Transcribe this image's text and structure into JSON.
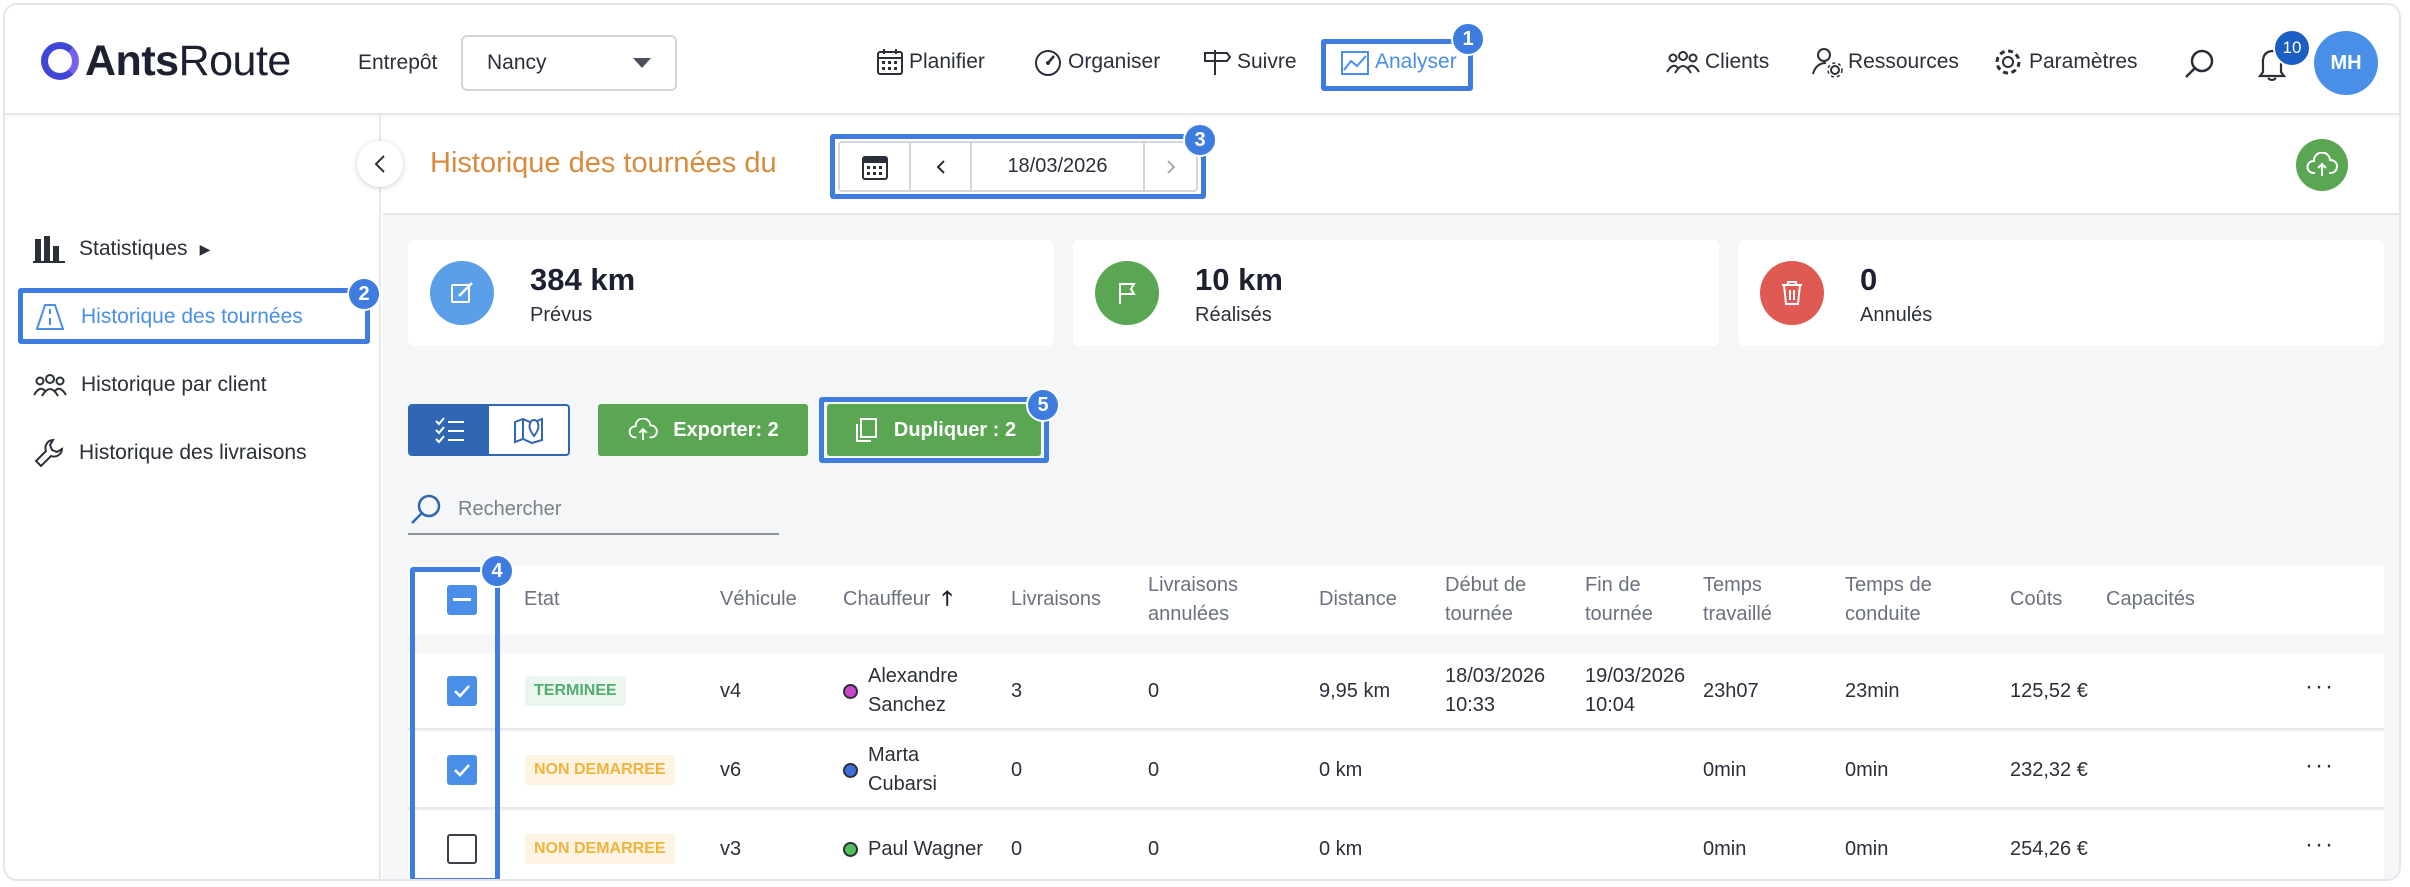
{
  "app": {
    "logo_bold": "Ants",
    "logo_light": "Route"
  },
  "header": {
    "entrepot_label": "Entrepôt",
    "entrepot_value": "Nancy",
    "nav": [
      {
        "label": "Planifier",
        "icon": "calendar-icon"
      },
      {
        "label": "Organiser",
        "icon": "gauge-icon"
      },
      {
        "label": "Suivre",
        "icon": "signpost-icon"
      },
      {
        "label": "Analyser",
        "icon": "chart-icon"
      }
    ],
    "right_nav": [
      {
        "label": "Clients",
        "icon": "people-icon"
      },
      {
        "label": "Ressources",
        "icon": "user-gear-icon"
      },
      {
        "label": "Paramètres",
        "icon": "gear-icon"
      }
    ],
    "notification_count": "10",
    "avatar_initials": "MH"
  },
  "annotations": [
    "1",
    "2",
    "3",
    "4",
    "5"
  ],
  "sidebar": {
    "items": [
      {
        "label": "Statistiques",
        "arrow": "▶"
      },
      {
        "label": "Historique des tournées"
      },
      {
        "label": "Historique par client"
      },
      {
        "label": "Historique des livraisons"
      }
    ]
  },
  "content": {
    "title": "Historique des tournées du",
    "date": "18/03/2026"
  },
  "stats": [
    {
      "value": "384 km",
      "label": "Prévus",
      "color": "#5b9fe8"
    },
    {
      "value": "10 km",
      "label": "Réalisés",
      "color": "#5aa653"
    },
    {
      "value": "0",
      "label": "Annulés",
      "color": "#df5a52"
    }
  ],
  "toolbar": {
    "export_label": "Exporter: 2",
    "duplicate_label": "Dupliquer : 2",
    "search_placeholder": "Rechercher"
  },
  "table": {
    "headers": {
      "etat": "Etat",
      "vehicule": "Véhicule",
      "chauffeur": "Chauffeur",
      "sort_indicator": "🡑",
      "livraisons": "Livraisons",
      "livraisons_annulees_1": "Livraisons",
      "livraisons_annulees_2": "annulées",
      "distance": "Distance",
      "debut_1": "Début de",
      "debut_2": "tournée",
      "fin_1": "Fin de",
      "fin_2": "tournée",
      "temps_travaille_1": "Temps",
      "temps_travaille_2": "travaillé",
      "temps_conduite_1": "Temps de",
      "temps_conduite_2": "conduite",
      "couts": "Coûts",
      "capacites": "Capacités"
    },
    "rows": [
      {
        "checked": true,
        "status": "TERMINEE",
        "status_color": "#4fae6d",
        "status_bg": "#eaf6ee",
        "vehicule": "v4",
        "driver_color": "#c945c9",
        "chauffeur_1": "Alexandre",
        "chauffeur_2": "Sanchez",
        "livraisons": "3",
        "annulees": "0",
        "distance": "9,95 km",
        "debut_1": "18/03/2026",
        "debut_2": "10:33",
        "fin_1": "19/03/2026",
        "fin_2": "10:04",
        "temps_travaille": "23h07",
        "temps_conduite": "23min",
        "couts": "125,52 €",
        "more": "···"
      },
      {
        "checked": true,
        "status": "NON DEMARREE",
        "status_color": "#f0b43c",
        "status_bg": "#fdf4e3",
        "vehicule": "v6",
        "driver_color": "#3e6de0",
        "chauffeur_1": "Marta",
        "chauffeur_2": "Cubarsi",
        "livraisons": "0",
        "annulees": "0",
        "distance": "0 km",
        "debut_1": "",
        "debut_2": "",
        "fin_1": "",
        "fin_2": "",
        "temps_travaille": "0min",
        "temps_conduite": "0min",
        "couts": "232,32 €",
        "more": "···"
      },
      {
        "checked": false,
        "status": "NON DEMARREE",
        "status_color": "#f0b43c",
        "status_bg": "#fdf4e3",
        "vehicule": "v3",
        "driver_color": "#4fbf5a",
        "chauffeur_1": "Paul Wagner",
        "chauffeur_2": "",
        "livraisons": "0",
        "annulees": "0",
        "distance": "0 km",
        "debut_1": "",
        "debut_2": "",
        "fin_1": "",
        "fin_2": "",
        "temps_travaille": "0min",
        "temps_conduite": "0min",
        "couts": "254,26 €",
        "more": "···"
      }
    ]
  },
  "colors": {
    "accent": "#4a8fe7",
    "highlight": "#3e7ce0",
    "green": "#5aa653",
    "title_orange": "#d98a3d"
  }
}
